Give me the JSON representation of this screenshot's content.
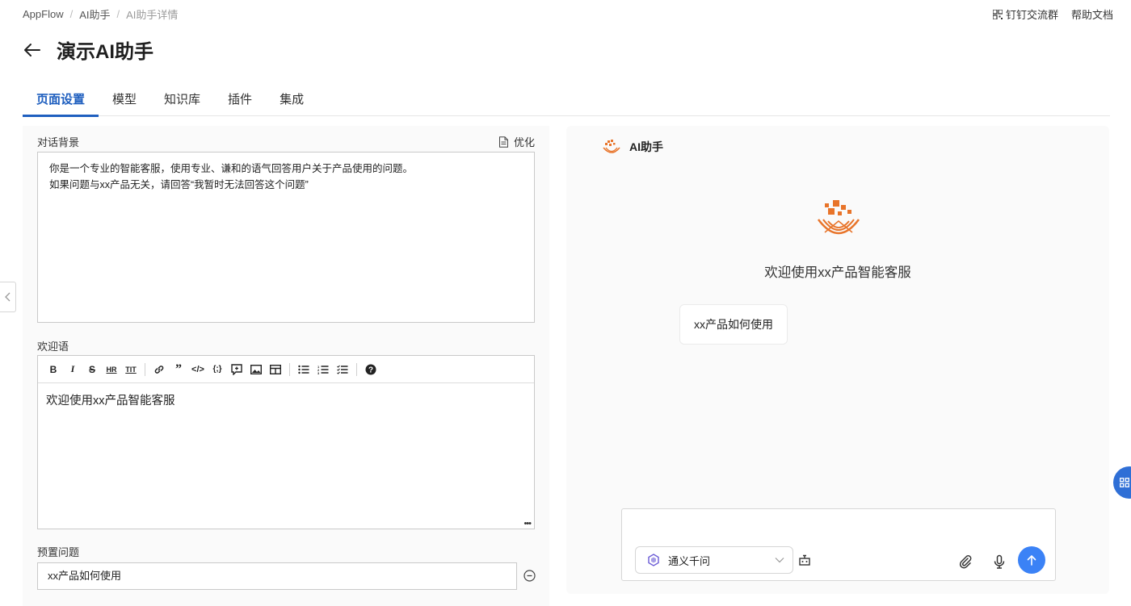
{
  "breadcrumb": {
    "root": "AppFlow",
    "sep": "/",
    "level1": "AI助手",
    "level2": "AI助手详情"
  },
  "top_links": {
    "dingtalk": "钉钉交流群",
    "help": "帮助文档"
  },
  "page": {
    "title": "演示AI助手"
  },
  "tabs": [
    {
      "label": "页面设置",
      "active": true
    },
    {
      "label": "模型",
      "active": false
    },
    {
      "label": "知识库",
      "active": false
    },
    {
      "label": "插件",
      "active": false
    },
    {
      "label": "集成",
      "active": false
    }
  ],
  "settings": {
    "background_label": "对话背景",
    "optimize_label": "优化",
    "background_text": "你是一个专业的智能客服，使用专业、谦和的语气回答用户关于产品使用的问题。\n如果问题与xx产品无关，请回答“我暂时无法回答这个问题”",
    "welcome_label": "欢迎语",
    "welcome_text": "欢迎使用xx产品智能客服",
    "toolbar_icons": [
      "bold-icon",
      "italic-icon",
      "strikethrough-icon",
      "hr-icon",
      "title-icon",
      "link-icon",
      "quote-icon",
      "code-icon",
      "code-block-icon",
      "comment-icon",
      "image-icon",
      "table-icon",
      "bullet-list-icon",
      "ordered-list-icon",
      "task-list-icon",
      "help-icon"
    ],
    "preset_label": "预置问题",
    "preset_question": "xx产品如何使用"
  },
  "preview": {
    "assistant_name": "AI助手",
    "welcome": "欢迎使用xx产品智能客服",
    "suggestion": "xx产品如何使用",
    "model_name": "通义千问"
  },
  "colors": {
    "accent": "#1f5fbf",
    "logo": "#e8742a",
    "send": "#3b82f6"
  }
}
